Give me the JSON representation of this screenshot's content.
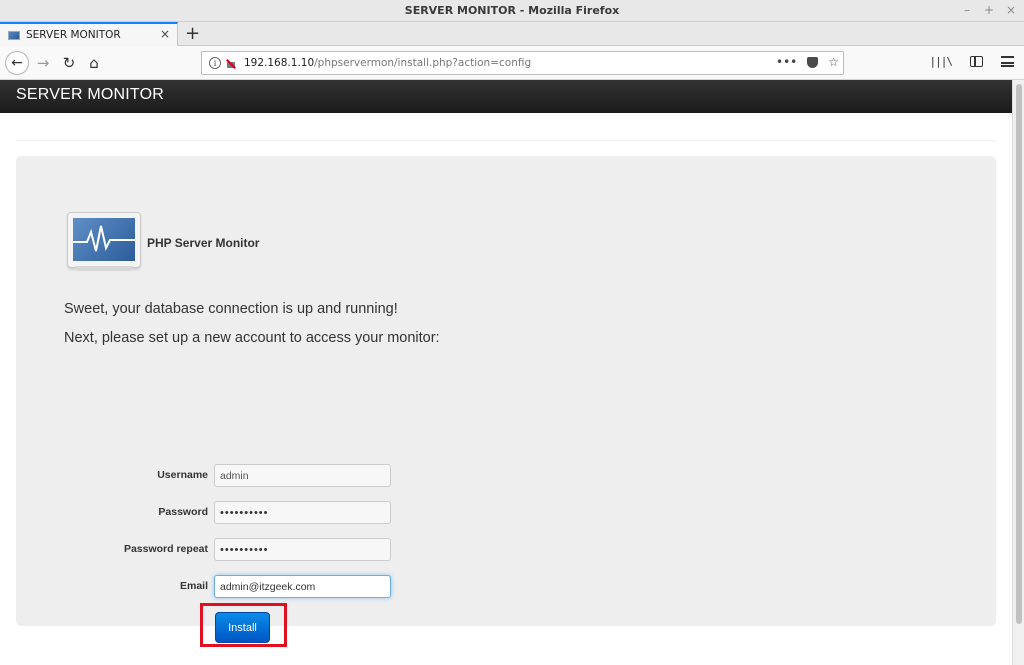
{
  "window": {
    "title": "SERVER MONITOR - Mozilla Firefox",
    "minimize": "–",
    "maximize": "+",
    "close": "×"
  },
  "tabs": [
    {
      "title": "SERVER MONITOR",
      "close": "×",
      "active": true
    }
  ],
  "newtab_label": "+",
  "toolbar": {
    "back": "←",
    "forward": "→",
    "reload": "↻",
    "home": "⌂",
    "url_host": "192.168.1.10",
    "url_path": "/phpservermon/install.php?action=config",
    "page_actions": "•••",
    "bookmark": "☆"
  },
  "app": {
    "brand": "SERVER MONITOR",
    "product_name": "PHP Server Monitor",
    "message_connected": "Sweet, your database connection is up and running!",
    "message_next": "Next, please set up a new account to access your monitor:"
  },
  "form": {
    "username_label": "Username",
    "username_value": "admin",
    "password_label": "Password",
    "password_value": "••••••••••",
    "password_repeat_label": "Password repeat",
    "password_repeat_value": "••••••••••",
    "email_label": "Email",
    "email_value": "admin@itzgeek.com",
    "install_label": "Install"
  },
  "colors": {
    "header_bg": "#222222",
    "panel_bg": "#eeeeee",
    "button_blue": "#0a6fd8",
    "highlight_red": "#e0101e"
  }
}
